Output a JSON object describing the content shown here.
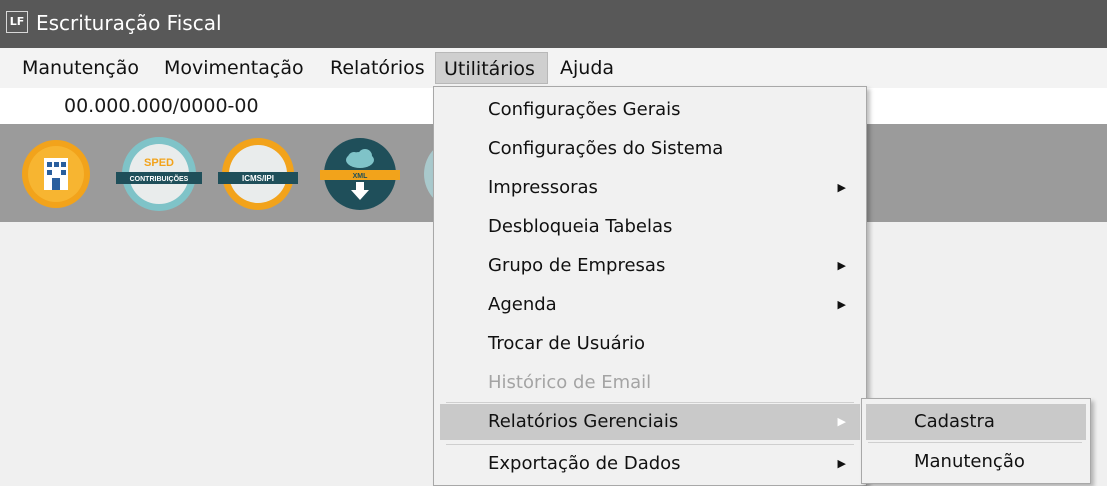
{
  "window": {
    "title": "Escrituração Fiscal",
    "icon_label": "LF"
  },
  "menubar": {
    "items": [
      {
        "label": "Manutenção"
      },
      {
        "label": "Movimentação"
      },
      {
        "label": "Relatórios"
      },
      {
        "label": "Utilitários",
        "active": true
      },
      {
        "label": "Ajuda"
      }
    ]
  },
  "company": {
    "cnpj": "00.000.000/0000-00"
  },
  "toolbar": {
    "buttons": [
      {
        "icon": "building-icon",
        "label": ""
      },
      {
        "icon": "sped-contribuicoes-icon",
        "label_top": "SPED",
        "label_band": "CONTRIBUIÇÕES"
      },
      {
        "icon": "icms-ipi-icon",
        "label_band": "ICMS/IPI"
      },
      {
        "icon": "xml-download-icon",
        "label_band": "XML"
      }
    ]
  },
  "utilitarios_menu": {
    "items": [
      {
        "label": "Configurações Gerais",
        "submenu": false,
        "enabled": true
      },
      {
        "label": "Configurações do Sistema",
        "submenu": false,
        "enabled": true
      },
      {
        "label": "Impressoras",
        "submenu": true,
        "enabled": true
      },
      {
        "label": "Desbloqueia Tabelas",
        "submenu": false,
        "enabled": true
      },
      {
        "label": "Grupo de Empresas",
        "submenu": true,
        "enabled": true
      },
      {
        "label": "Agenda",
        "submenu": true,
        "enabled": true
      },
      {
        "label": "Trocar de Usuário",
        "submenu": false,
        "enabled": true
      },
      {
        "label": "Histórico de Email",
        "submenu": false,
        "enabled": false
      },
      {
        "label": "Relatórios Gerenciais",
        "submenu": true,
        "enabled": true,
        "highlighted": true
      },
      {
        "label": "Exportação de Dados",
        "submenu": true,
        "enabled": true
      }
    ]
  },
  "relatorios_gerenciais_submenu": {
    "items": [
      {
        "label": "Cadastra",
        "highlighted": true
      },
      {
        "label": "Manutenção"
      }
    ]
  },
  "colors": {
    "titlebar": "#585858",
    "toolbar": "#9b9b9b",
    "highlight": "#c9c9c9",
    "icon_orange": "#f2a31b",
    "icon_teal": "#4a9ba3",
    "icon_dark": "#1f4f5a",
    "icon_blue": "#2a5f9e"
  }
}
